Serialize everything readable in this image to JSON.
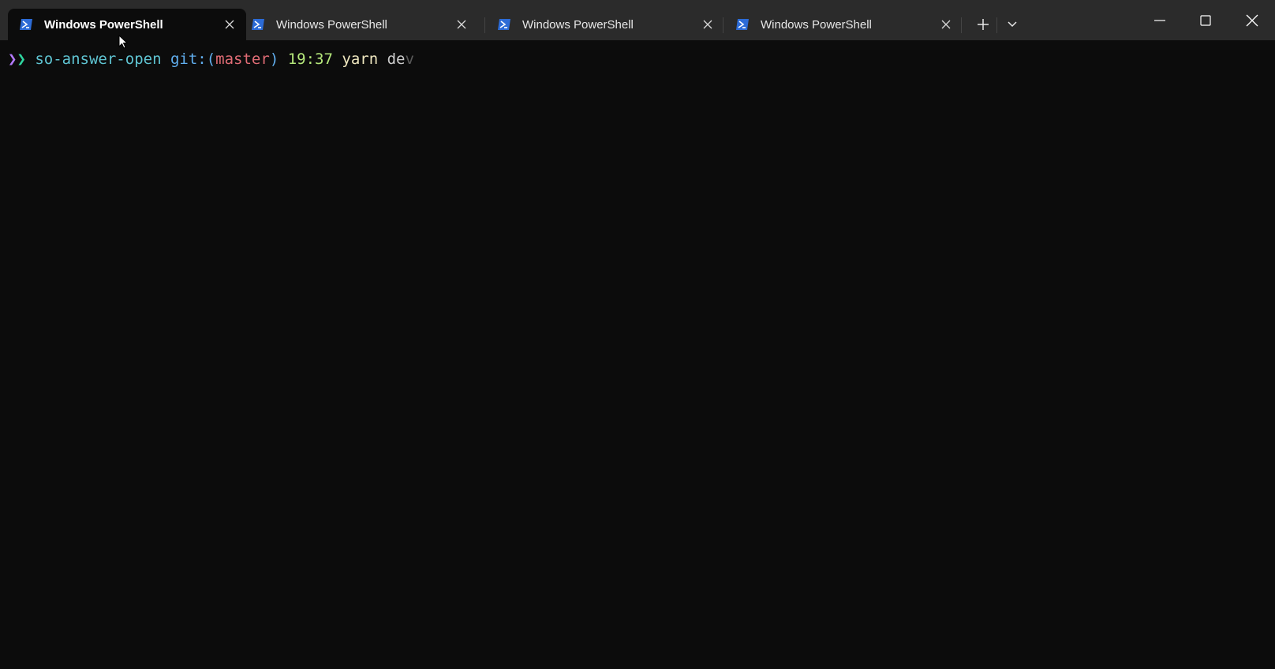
{
  "tabs": [
    {
      "title": "Windows PowerShell",
      "active": true,
      "icon": "powershell-icon"
    },
    {
      "title": "Windows PowerShell",
      "active": false,
      "icon": "powershell-icon"
    },
    {
      "title": "Windows PowerShell",
      "active": false,
      "icon": "powershell-icon"
    },
    {
      "title": "Windows PowerShell",
      "active": false,
      "icon": "powershell-icon"
    }
  ],
  "tabbar": {
    "new_tab_icon": "plus-icon",
    "dropdown_icon": "chevron-down-icon"
  },
  "window_controls": {
    "minimize_icon": "minimize-icon",
    "maximize_icon": "maximize-icon",
    "close_icon": "close-icon"
  },
  "prompt": {
    "arrows": "❯❯",
    "directory": "so-answer-open",
    "git_label": "git:(",
    "branch": "master",
    "git_close": ")",
    "time": "19:37",
    "command": "yarn",
    "typed_arg": "de",
    "suggestion": "v"
  },
  "colors": {
    "background": "#0c0c0c",
    "titlebar": "#2b2b2b",
    "directory": "#5fc4d2",
    "git": "#61afef",
    "branch": "#e06c75",
    "time": "#b5e87b",
    "command": "#f0e8c0",
    "suggestion": "#5a5a5a"
  }
}
